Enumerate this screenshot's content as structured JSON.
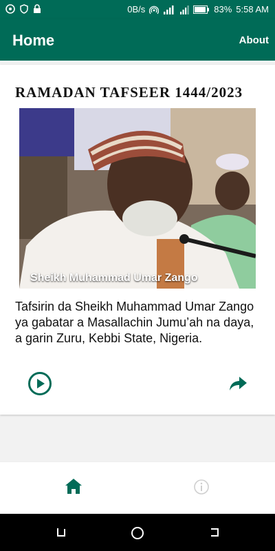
{
  "status_bar": {
    "left_icons": [
      "notification-icon",
      "shield-icon",
      "lock-icon"
    ],
    "data_rate": "0B/s",
    "battery": "83%",
    "time": "5:58 AM"
  },
  "app_bar": {
    "title": "Home",
    "about_label": "About"
  },
  "card": {
    "heading": "RAMADAN TAFSEER 1444/2023",
    "image_caption": "Sheikh Muhammad Umar Zango",
    "description": "Tafsirin da Sheikh Muhammad Umar Zango ya gabatar a Masallachin Jumu’ah na daya, a garin Zuru, Kebbi State, Nigeria.",
    "actions": [
      "play-icon",
      "share-icon"
    ]
  },
  "bottom_nav": {
    "items": [
      {
        "icon": "home-icon",
        "selected": true
      },
      {
        "icon": "info-icon",
        "selected": false
      }
    ]
  },
  "colors": {
    "primary": "#006b57",
    "background": "#f2f2f2",
    "card": "#ffffff",
    "text": "#111111"
  }
}
